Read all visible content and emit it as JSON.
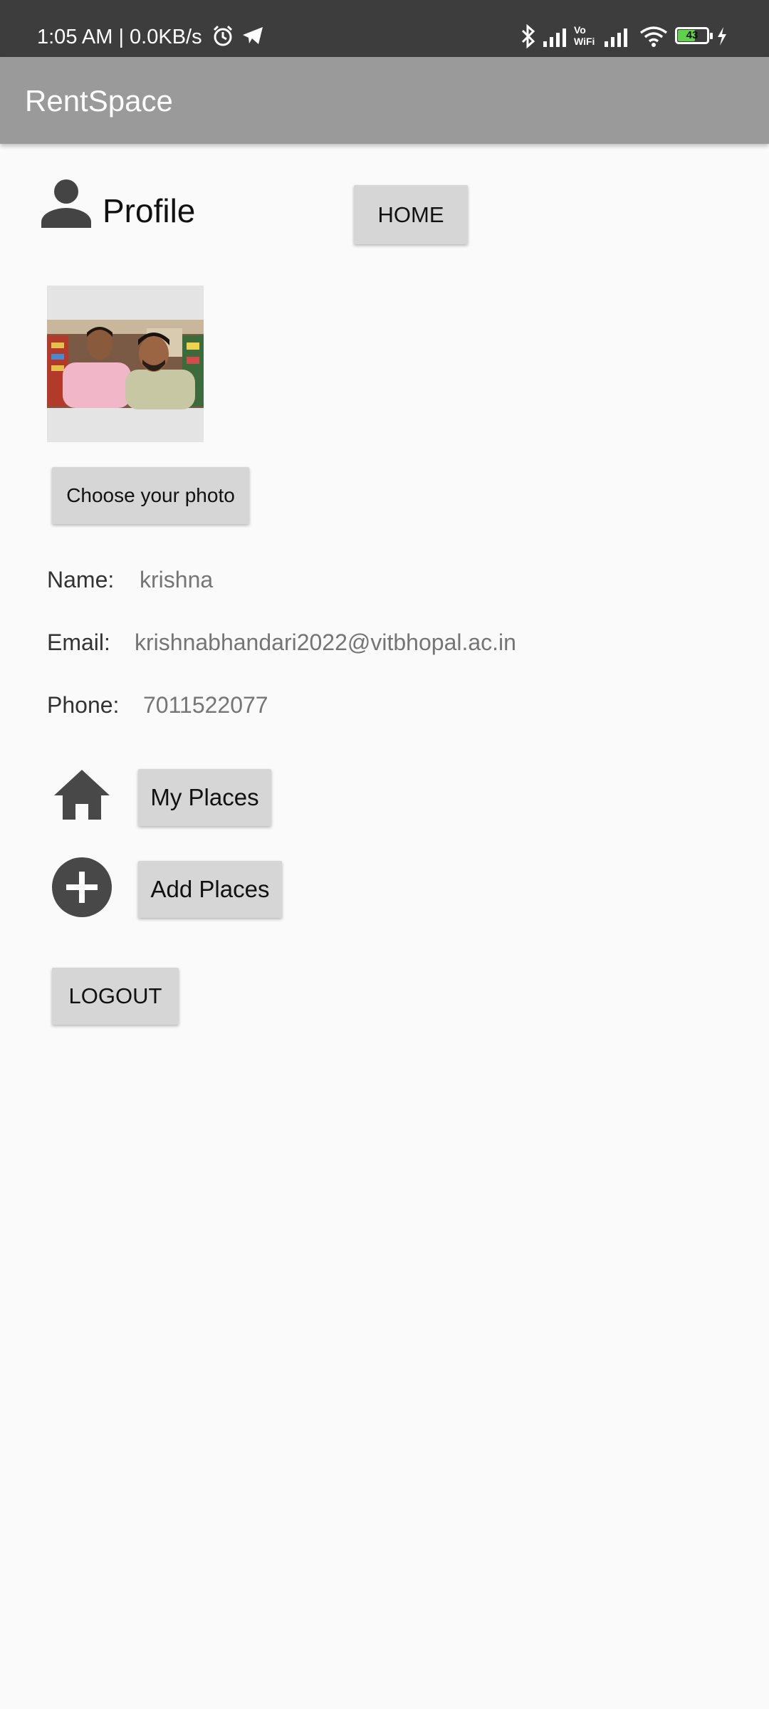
{
  "status": {
    "time": "1:05 AM | 0.0KB/s",
    "battery": "43",
    "vowifi": "Vo WiFi"
  },
  "app": {
    "title": "RentSpace"
  },
  "profile": {
    "heading": "Profile",
    "home_label": "HOME",
    "choose_photo_label": "Choose your photo"
  },
  "fields": {
    "name_label": "Name:",
    "name_value": "krishna",
    "email_label": "Email:",
    "email_value": "krishnabhandari2022@vitbhopal.ac.in",
    "phone_label": "Phone:",
    "phone_value": "7011522077"
  },
  "actions": {
    "my_places_label": "My Places",
    "add_places_label": "Add Places",
    "logout_label": "LOGOUT"
  },
  "icons": {
    "profile": "person-icon",
    "my_places": "home-icon",
    "add_places": "add-circle-icon"
  },
  "colors": {
    "status_bar": "#3d3d3d",
    "app_bar": "#9a9a9a",
    "button": "#d6d6d6",
    "background": "#fafafa"
  }
}
